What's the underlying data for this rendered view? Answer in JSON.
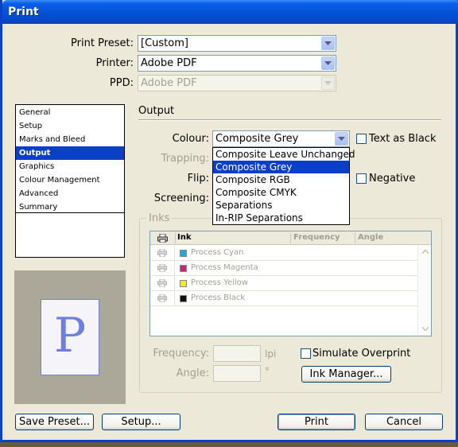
{
  "window": {
    "title": "Print"
  },
  "preset": {
    "label": "Print Preset:",
    "value": "[Custom]"
  },
  "printer": {
    "label": "Printer:",
    "value": "Adobe PDF"
  },
  "ppd": {
    "label": "PPD:",
    "value": "Adobe PDF"
  },
  "nav": {
    "items": [
      {
        "label": "General",
        "selected": false
      },
      {
        "label": "Setup",
        "selected": false
      },
      {
        "label": "Marks and Bleed",
        "selected": false
      },
      {
        "label": "Output",
        "selected": true
      },
      {
        "label": "Graphics",
        "selected": false
      },
      {
        "label": "Colour Management",
        "selected": false
      },
      {
        "label": "Advanced",
        "selected": false
      },
      {
        "label": "Summary",
        "selected": false
      }
    ]
  },
  "preview": {
    "glyph": "P"
  },
  "output": {
    "section_title": "Output",
    "colour_label": "Colour:",
    "colour_value": "Composite Grey",
    "text_as_black": "Text as Black",
    "trapping_label": "Trapping:",
    "flip_label": "Flip:",
    "negative_label": "Negative",
    "screening_label": "Screening:",
    "colour_options": [
      {
        "label": "Composite Leave Unchanged",
        "selected": false
      },
      {
        "label": "Composite Grey",
        "selected": true
      },
      {
        "label": "Composite RGB",
        "selected": false
      },
      {
        "label": "Composite CMYK",
        "selected": false
      },
      {
        "label": "Separations",
        "selected": false
      },
      {
        "label": "In-RIP Separations",
        "selected": false
      }
    ]
  },
  "inks": {
    "group_label": "Inks",
    "columns": {
      "ink": "Ink",
      "frequency": "Frequency",
      "angle": "Angle"
    },
    "rows": [
      {
        "name": "Process Cyan",
        "color": "#1fa9e0"
      },
      {
        "name": "Process Magenta",
        "color": "#d0207a"
      },
      {
        "name": "Process Yellow",
        "color": "#f2ea1a"
      },
      {
        "name": "Process Black",
        "color": "#111111"
      }
    ],
    "frequency_label": "Frequency:",
    "frequency_unit": "lpi",
    "angle_label": "Angle:",
    "angle_unit": "°",
    "simulate_overprint": "Simulate Overprint",
    "ink_manager": "Ink Manager..."
  },
  "buttons": {
    "save_preset": "Save Preset...",
    "setup": "Setup...",
    "print": "Print",
    "cancel": "Cancel"
  },
  "colors": {
    "accent": "#0a3fc8",
    "dialog_bg": "#ece9d8"
  }
}
